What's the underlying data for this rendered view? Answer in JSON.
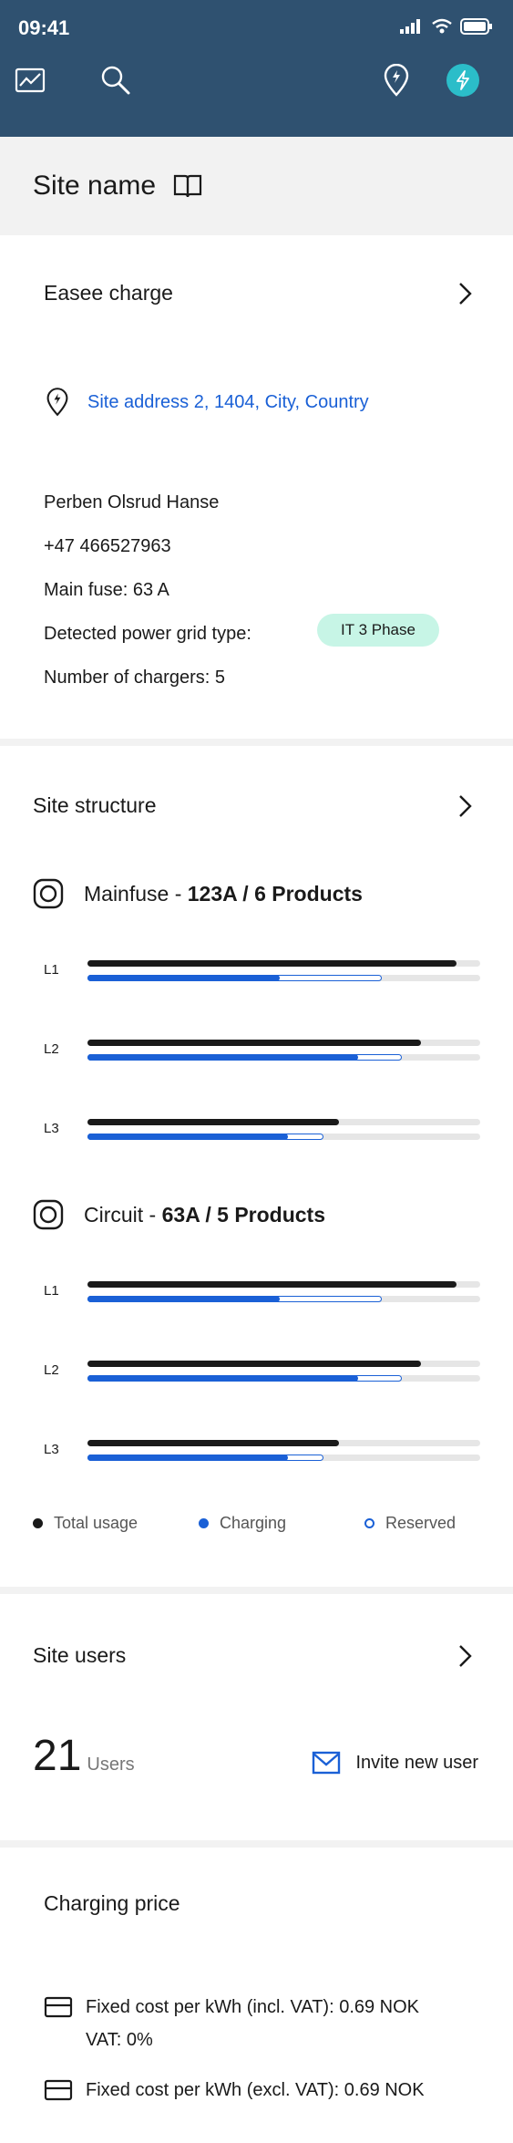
{
  "status_bar": {
    "time": "09:41"
  },
  "header_icons": [
    "analytics-icon",
    "search-icon",
    "location-pin-icon",
    "lightning-icon"
  ],
  "title": {
    "text": "Site name"
  },
  "site": {
    "name": "Easee charge",
    "address": "Site address 2, 1404, City, Country",
    "contact": "Perben Olsrud Hanse",
    "phone": "+47 466527963",
    "main_fuse": "Main fuse: 63 A",
    "grid_label": "Detected power grid type:",
    "grid_badge": "IT 3 Phase",
    "chargers": "Number of chargers: 5"
  },
  "structure": {
    "title": "Site structure",
    "groups": [
      {
        "prefix": "Mainfuse - ",
        "bold": "123A / 6 Products",
        "phases": [
          {
            "label": "L1",
            "total": 0.94,
            "charging": 0.49,
            "reserved": 0.75
          },
          {
            "label": "L2",
            "total": 0.85,
            "charging": 0.69,
            "reserved": 0.8
          },
          {
            "label": "L3",
            "total": 0.64,
            "charging": 0.51,
            "reserved": 0.6
          }
        ]
      },
      {
        "prefix": "Circuit - ",
        "bold": "63A / 5 Products",
        "phases": [
          {
            "label": "L1",
            "total": 0.94,
            "charging": 0.49,
            "reserved": 0.75
          },
          {
            "label": "L2",
            "total": 0.85,
            "charging": 0.69,
            "reserved": 0.8
          },
          {
            "label": "L3",
            "total": 0.64,
            "charging": 0.51,
            "reserved": 0.6
          }
        ]
      }
    ],
    "legend": {
      "total": "Total usage",
      "charging": "Charging",
      "reserved": "Reserved"
    },
    "colors": {
      "total": "#1a1a1a",
      "charging": "#1a60d6",
      "track": "#e6e6e6"
    }
  },
  "users": {
    "title": "Site users",
    "count": "21",
    "unit": "Users",
    "invite": "Invite new user"
  },
  "pricing": {
    "title": "Charging price",
    "incl": "Fixed cost per kWh (incl. VAT): 0.69 NOK",
    "vat": "VAT: 0%",
    "excl": "Fixed cost per kWh (excl. VAT): 0.69 NOK"
  }
}
